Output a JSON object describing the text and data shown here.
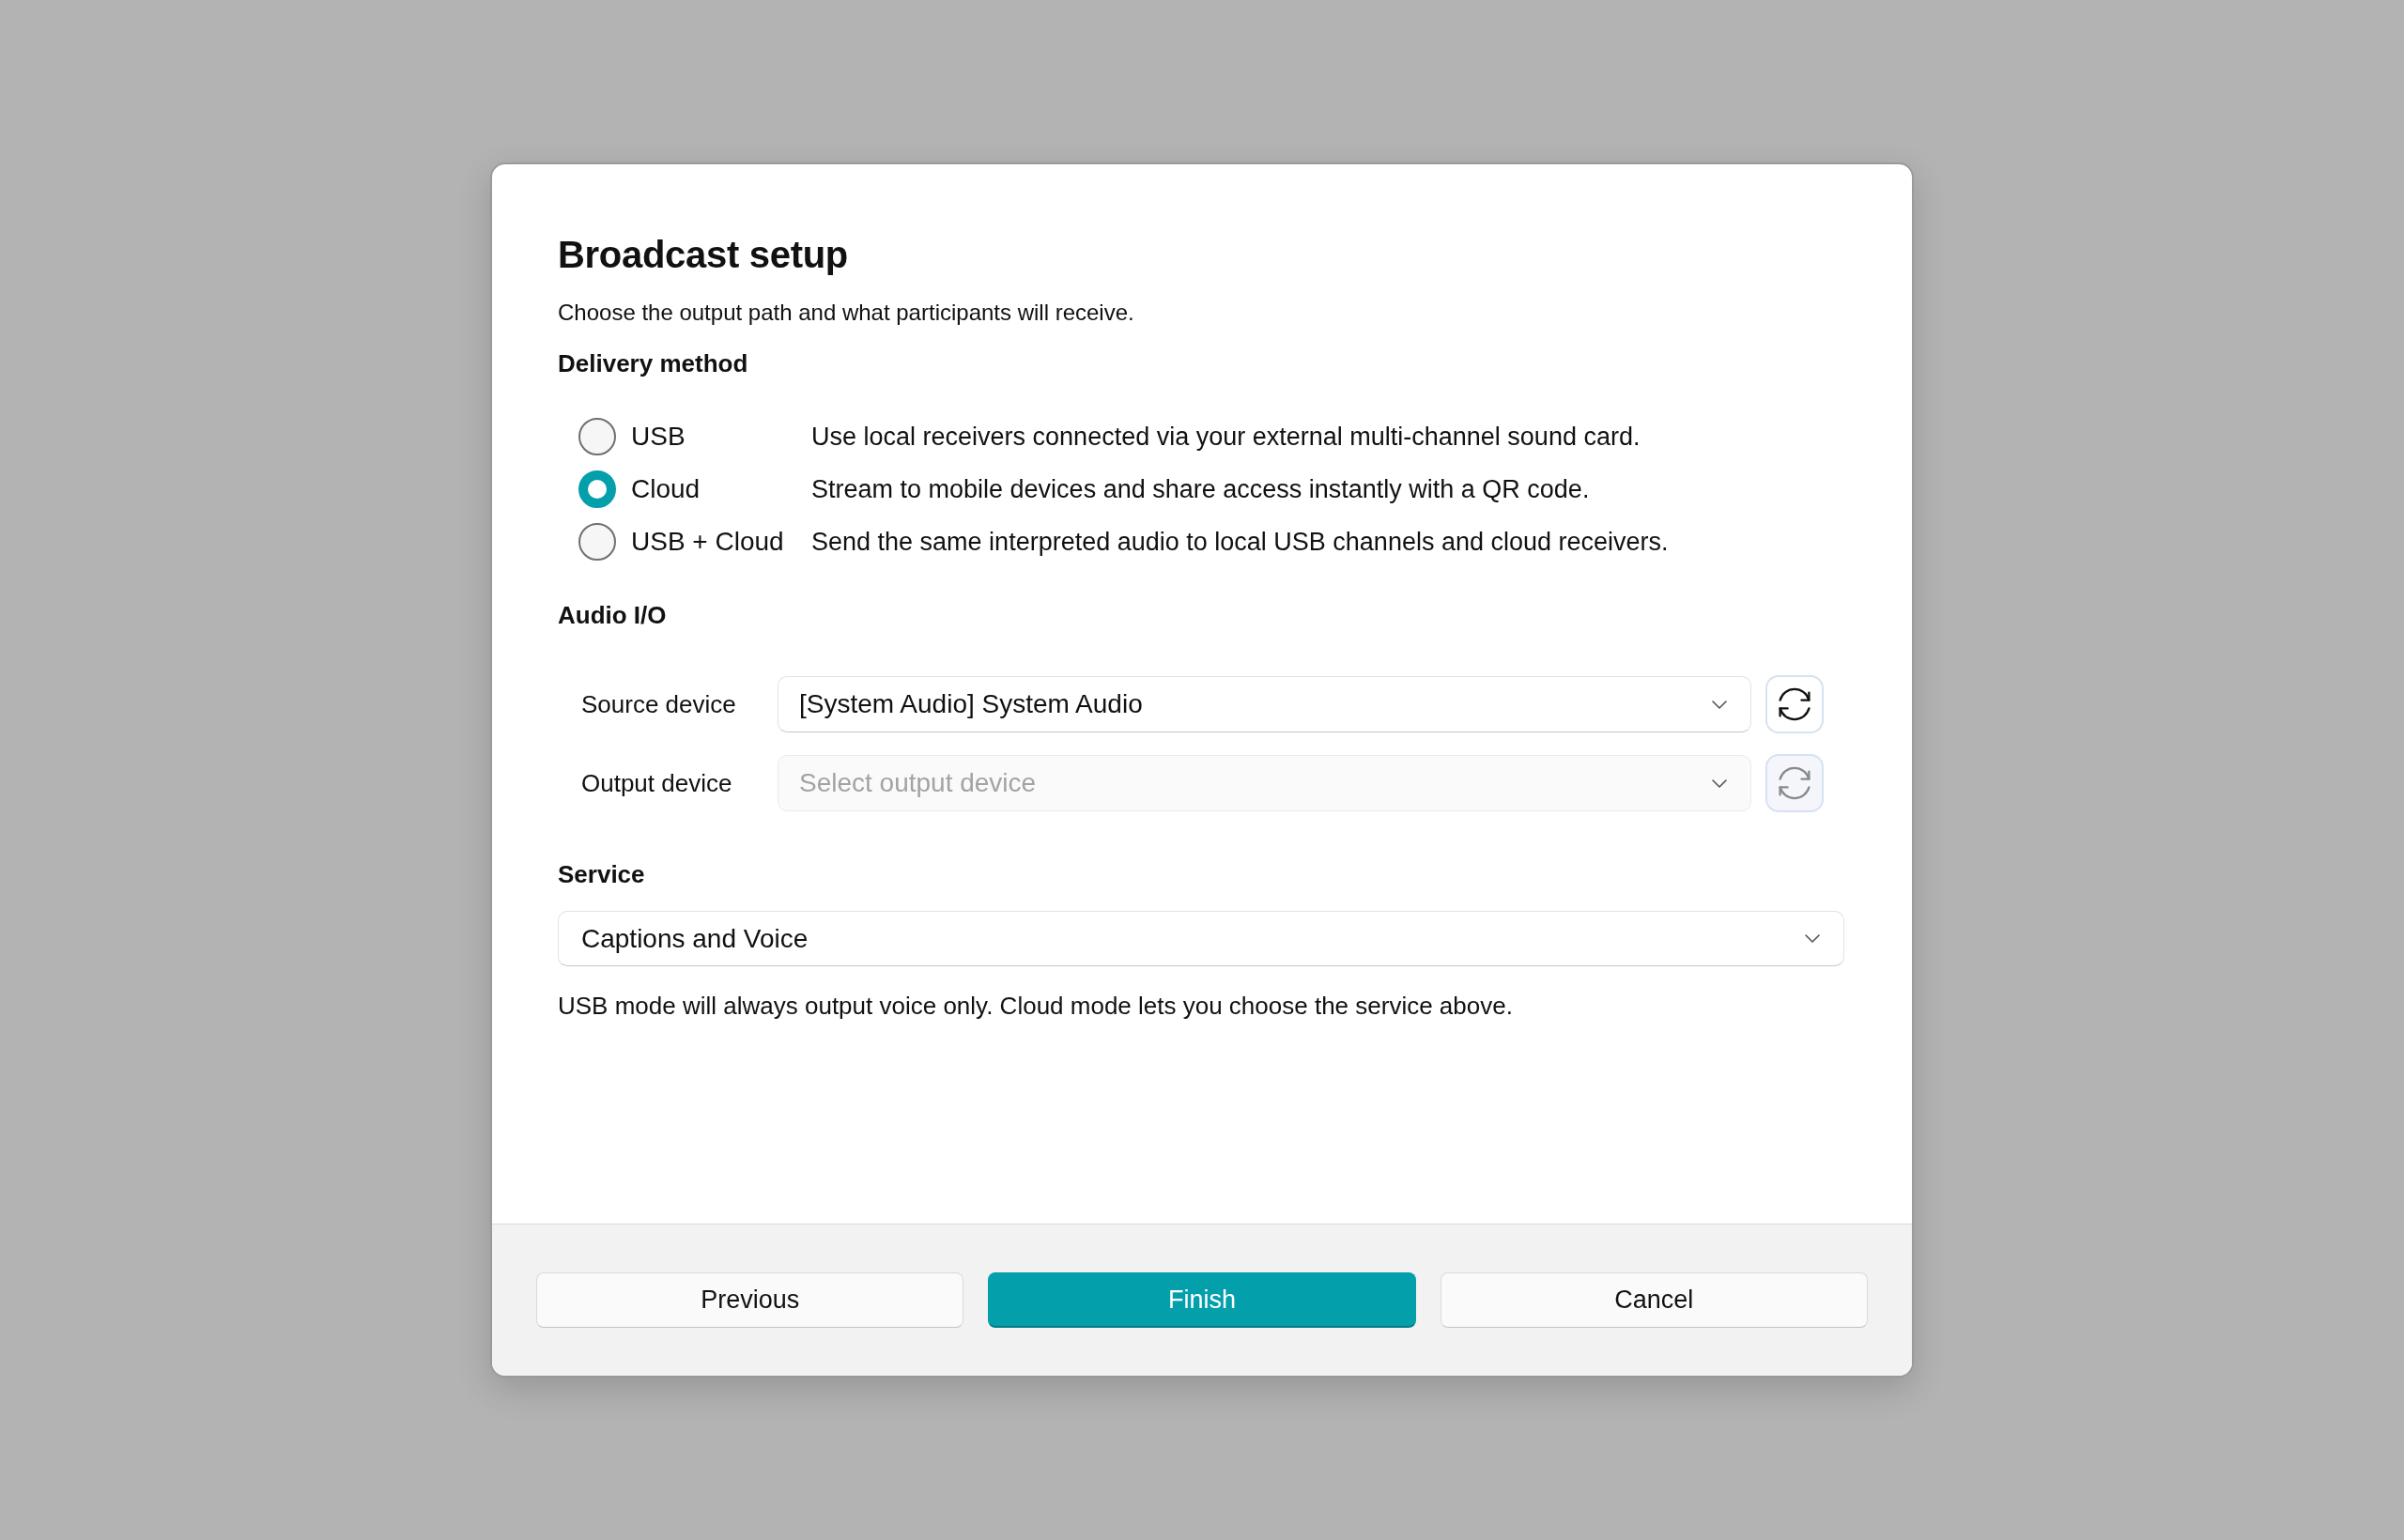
{
  "dialog": {
    "title": "Broadcast setup",
    "subtitle": "Choose the output path and what participants will receive."
  },
  "delivery_method": {
    "heading": "Delivery method",
    "options": [
      {
        "label": "USB",
        "description": "Use local receivers connected via your external multi-channel sound card.",
        "selected": false
      },
      {
        "label": "Cloud",
        "description": "Stream to mobile devices and share access instantly with a QR code.",
        "selected": true
      },
      {
        "label": "USB + Cloud",
        "description": "Send the same interpreted audio to local USB channels and cloud receivers.",
        "selected": false
      }
    ]
  },
  "audio_io": {
    "heading": "Audio I/O",
    "rows": [
      {
        "label": "Source device",
        "value": "[System Audio] System Audio",
        "disabled": false
      },
      {
        "label": "Output device",
        "placeholder": "Select output device",
        "disabled": true
      }
    ]
  },
  "service": {
    "heading": "Service",
    "value": "Captions and Voice",
    "note": "USB mode will always output voice only. Cloud mode lets you choose the service above."
  },
  "buttons": [
    {
      "label": "Previous",
      "kind": "secondary"
    },
    {
      "label": "Finish",
      "kind": "primary"
    },
    {
      "label": "Cancel",
      "kind": "secondary"
    }
  ]
}
